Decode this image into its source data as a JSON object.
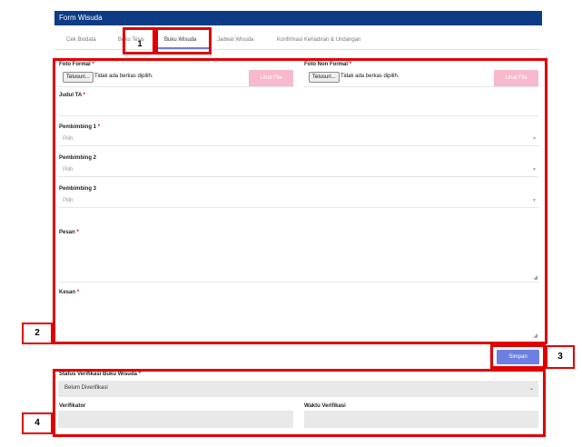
{
  "form": {
    "title": "Form Wisuda"
  },
  "tabs": [
    {
      "label": "Cek Biodata"
    },
    {
      "label": "Buku Tesis"
    },
    {
      "label": "Buku Wisuda"
    },
    {
      "label": "Jadwal Wisuda"
    },
    {
      "label": "Konfirmasi Kehadiran & Undangan"
    }
  ],
  "fields": {
    "foto_formal": {
      "label": "Foto Formal",
      "required": "*",
      "browse": "Telusuri...",
      "status": "Tidak ada berkas dipilih.",
      "view": "Lihat File"
    },
    "foto_non_formal": {
      "label": "Foto Non Formal",
      "required": "*",
      "browse": "Telusuri...",
      "status": "Tidak ada berkas dipilih.",
      "view": "Lihat File"
    },
    "judul_ta": {
      "label": "Judul TA",
      "required": "*"
    },
    "pembimbing1": {
      "label": "Pembimbing 1",
      "required": "*",
      "placeholder": "Pilih"
    },
    "pembimbing2": {
      "label": "Pembimbing 2",
      "placeholder": "Pilih"
    },
    "pembimbing3": {
      "label": "Pembimbing 3",
      "placeholder": "Pilih"
    },
    "pesan": {
      "label": "Pesan",
      "required": "*"
    },
    "kesan": {
      "label": "Kesan",
      "required": "*"
    }
  },
  "actions": {
    "save": "Simpan"
  },
  "verification": {
    "status_label": "Status Verifikasi Buku Wisuda",
    "required": "*",
    "status_value": "Belum Diverifikasi",
    "verifikator_label": "Verifikator",
    "waktu_label": "Waktu Verifikasi"
  },
  "annotations": [
    "1",
    "2",
    "3",
    "4"
  ],
  "colors": {
    "header": "#0d3b85",
    "accent": "#6d7fe0",
    "view_button": "#f8b9cc",
    "annotation": "#e00000"
  }
}
